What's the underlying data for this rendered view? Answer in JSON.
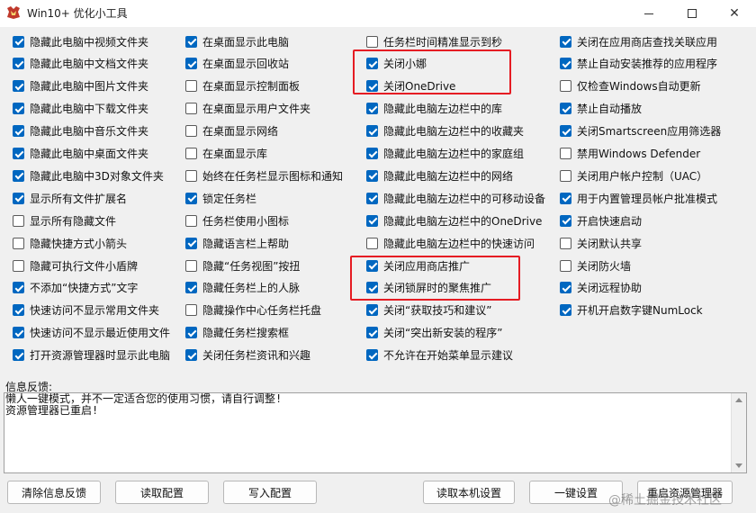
{
  "window": {
    "title": "Win10+ 优化小工具",
    "controls": {
      "minimize": "",
      "maximize": "",
      "close": "✕"
    }
  },
  "options": {
    "col1": [
      {
        "label": "隐藏此电脑中视频文件夹",
        "checked": true
      },
      {
        "label": "隐藏此电脑中文档文件夹",
        "checked": true
      },
      {
        "label": "隐藏此电脑中图片文件夹",
        "checked": true
      },
      {
        "label": "隐藏此电脑中下载文件夹",
        "checked": true
      },
      {
        "label": "隐藏此电脑中音乐文件夹",
        "checked": true
      },
      {
        "label": "隐藏此电脑中桌面文件夹",
        "checked": true
      },
      {
        "label": "隐藏此电脑中3D对象文件夹",
        "checked": true
      },
      {
        "label": "显示所有文件扩展名",
        "checked": true
      },
      {
        "label": "显示所有隐藏文件",
        "checked": false
      },
      {
        "label": "隐藏快捷方式小箭头",
        "checked": false
      },
      {
        "label": "隐藏可执行文件小盾牌",
        "checked": false
      },
      {
        "label": "不添加“快捷方式”文字",
        "checked": true
      },
      {
        "label": "快速访问不显示常用文件夹",
        "checked": true
      },
      {
        "label": "快速访问不显示最近使用文件",
        "checked": true
      },
      {
        "label": "打开资源管理器时显示此电脑",
        "checked": true
      }
    ],
    "col2": [
      {
        "label": "在桌面显示此电脑",
        "checked": true
      },
      {
        "label": "在桌面显示回收站",
        "checked": true
      },
      {
        "label": "在桌面显示控制面板",
        "checked": false
      },
      {
        "label": "在桌面显示用户文件夹",
        "checked": false
      },
      {
        "label": "在桌面显示网络",
        "checked": false
      },
      {
        "label": "在桌面显示库",
        "checked": false
      },
      {
        "label": "始终在任务栏显示图标和通知",
        "checked": false
      },
      {
        "label": "锁定任务栏",
        "checked": true
      },
      {
        "label": "任务栏使用小图标",
        "checked": false
      },
      {
        "label": "隐藏语言栏上帮助",
        "checked": true
      },
      {
        "label": "隐藏“任务视图”按扭",
        "checked": false
      },
      {
        "label": "隐藏任务栏上的人脉",
        "checked": true
      },
      {
        "label": "隐藏操作中心任务栏托盘",
        "checked": false
      },
      {
        "label": "隐藏任务栏搜索框",
        "checked": true
      },
      {
        "label": "关闭任务栏资讯和兴趣",
        "checked": true
      }
    ],
    "col3": [
      {
        "label": "任务栏时间精准显示到秒",
        "checked": false
      },
      {
        "label": "关闭小娜",
        "checked": true
      },
      {
        "label": "关闭OneDrive",
        "checked": true
      },
      {
        "label": "隐藏此电脑左边栏中的库",
        "checked": true
      },
      {
        "label": "隐藏此电脑左边栏中的收藏夹",
        "checked": true
      },
      {
        "label": "隐藏此电脑左边栏中的家庭组",
        "checked": true
      },
      {
        "label": "隐藏此电脑左边栏中的网络",
        "checked": true
      },
      {
        "label": "隐藏此电脑左边栏中的可移动设备",
        "checked": true
      },
      {
        "label": "隐藏此电脑左边栏中的OneDrive",
        "checked": true
      },
      {
        "label": "隐藏此电脑左边栏中的快速访问",
        "checked": false
      },
      {
        "label": "关闭应用商店推广",
        "checked": true
      },
      {
        "label": "关闭锁屏时的聚焦推广",
        "checked": true
      },
      {
        "label": "关闭“获取技巧和建议”",
        "checked": true
      },
      {
        "label": "关闭“突出新安装的程序”",
        "checked": true
      },
      {
        "label": "不允许在开始菜单显示建议",
        "checked": true
      }
    ],
    "col4": [
      {
        "label": "关闭在应用商店查找关联应用",
        "checked": true
      },
      {
        "label": "禁止自动安装推荐的应用程序",
        "checked": true
      },
      {
        "label": "仅检查Windows自动更新",
        "checked": false
      },
      {
        "label": "禁止自动播放",
        "checked": true
      },
      {
        "label": "关闭Smartscreen应用筛选器",
        "checked": true
      },
      {
        "label": "禁用Windows Defender",
        "checked": false
      },
      {
        "label": "关闭用户帐户控制（UAC）",
        "checked": false
      },
      {
        "label": "用于内置管理员帐户批准模式",
        "checked": true
      },
      {
        "label": "开启快速启动",
        "checked": true
      },
      {
        "label": "关闭默认共享",
        "checked": false
      },
      {
        "label": "关闭防火墙",
        "checked": false
      },
      {
        "label": "关闭远程协助",
        "checked": true
      },
      {
        "label": "开机开启数字键NumLock",
        "checked": true
      }
    ]
  },
  "info": {
    "label": "信息反馈:",
    "lines": [
      "懒人一键模式，并不一定适合您的使用习惯，请自行调整!",
      "资源管理器已重启!"
    ]
  },
  "buttons": {
    "clear": "清除信息反馈",
    "read_config": "读取配置",
    "write_config": "写入配置",
    "read_local": "读取本机设置",
    "one_click": "一键设置",
    "restart_explorer": "重启资源管理器"
  },
  "watermark": "@稀土掘金技术社区",
  "colors": {
    "accent": "#0067c0",
    "highlight": "#e51c23"
  }
}
